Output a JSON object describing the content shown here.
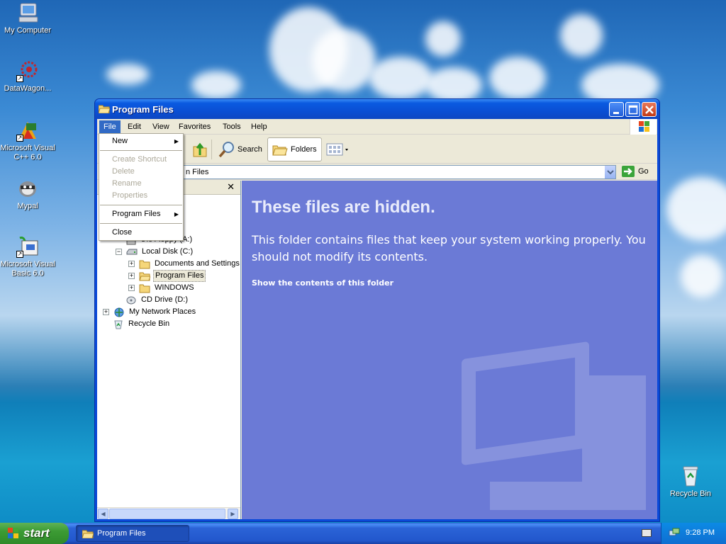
{
  "desktop": {
    "icons": [
      {
        "label": "My Computer",
        "icon": "my-computer-icon"
      },
      {
        "label": "DataWagon...",
        "icon": "datawagon-icon"
      },
      {
        "label": "Microsoft Visual C++ 6.0",
        "icon": "visual-cpp-icon"
      },
      {
        "label": "Mypal",
        "icon": "mypal-icon"
      },
      {
        "label": "Microsoft Visual Basic 6.0",
        "icon": "visual-basic-icon"
      },
      {
        "label": "Recycle Bin",
        "icon": "recycle-bin-icon"
      }
    ]
  },
  "window": {
    "title": "Program Files",
    "menu": [
      "File",
      "Edit",
      "View",
      "Favorites",
      "Tools",
      "Help"
    ],
    "toolbar": {
      "search_label": "Search",
      "folders_label": "Folders"
    },
    "address": {
      "value": "n Files",
      "go_label": "Go"
    },
    "tree": {
      "items": [
        {
          "label": "3½ Floppy (A:)",
          "expander": "",
          "icon": "floppy-icon"
        },
        {
          "label": "Local Disk (C:)",
          "expander": "−",
          "icon": "disk-icon"
        },
        {
          "label": "Documents and Settings",
          "expander": "+",
          "icon": "folder-icon"
        },
        {
          "label": "Program Files",
          "expander": "+",
          "icon": "folder-icon"
        },
        {
          "label": "WINDOWS",
          "expander": "+",
          "icon": "folder-icon"
        },
        {
          "label": "CD Drive (D:)",
          "expander": "",
          "icon": "cd-drive-icon"
        },
        {
          "label": "My Network Places",
          "expander": "+",
          "icon": "network-icon"
        },
        {
          "label": "Recycle Bin",
          "expander": "",
          "icon": "recycle-bin-icon"
        }
      ]
    },
    "content": {
      "heading": "These files are hidden.",
      "message": "This folder contains files that keep your system working properly. You should not modify its contents.",
      "link": "Show the contents of this folder"
    }
  },
  "file_menu": {
    "items": [
      {
        "label": "New",
        "enabled": true,
        "submenu": true
      },
      {
        "label": "Create Shortcut",
        "enabled": false
      },
      {
        "label": "Delete",
        "enabled": false
      },
      {
        "label": "Rename",
        "enabled": false
      },
      {
        "label": "Properties",
        "enabled": false
      },
      {
        "label": "Program Files",
        "enabled": true,
        "submenu": true
      },
      {
        "label": "Close",
        "enabled": true
      }
    ]
  },
  "taskbar": {
    "start_label": "start",
    "task": "Program Files",
    "clock": "9:28 PM"
  }
}
